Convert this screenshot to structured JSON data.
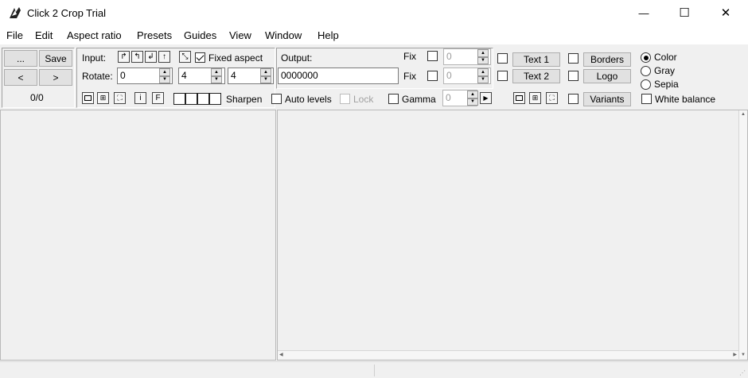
{
  "window": {
    "title": "Click 2 Crop Trial",
    "minimize_glyph": "—",
    "maximize_glyph": "☐",
    "close_glyph": "✕"
  },
  "menu": [
    "File",
    "Edit",
    "Aspect ratio",
    "Presets",
    "Guides",
    "View",
    "Window",
    "Help"
  ],
  "nav": {
    "browse_label": "...",
    "save_label": "Save",
    "prev_label": "<",
    "next_label": ">",
    "counter": "0/0"
  },
  "input": {
    "label": "Input:",
    "rotate_label": "Rotate:",
    "rotate_value": "0",
    "aspect_w": "4",
    "aspect_h": "4",
    "fixed_aspect_label": "Fixed aspect",
    "fixed_aspect_checked": true,
    "sharpen_label": "Sharpen",
    "auto_levels_label": "Auto levels",
    "lock_label": "Lock",
    "gamma_label": "Gamma",
    "gamma_value": "0"
  },
  "output": {
    "label": "Output:",
    "value": "0000000",
    "fix_label_1": "Fix",
    "fix_value_1": "0",
    "fix_label_2": "Fix",
    "fix_value_2": "0"
  },
  "overlays": {
    "text1_label": "Text 1",
    "text2_label": "Text 2",
    "borders_label": "Borders",
    "logo_label": "Logo",
    "variants_label": "Variants"
  },
  "color_mode": {
    "options": [
      "Color",
      "Gray",
      "Sepia"
    ],
    "selected": "Color",
    "white_balance_label": "White balance"
  },
  "icons": {
    "glyph_rotate_cw": "↱",
    "glyph_rotate_ccw": "↰",
    "glyph_flip": "↲",
    "glyph_up": "↑",
    "glyph_shrink": "⤡",
    "glyph_info": "i",
    "glyph_text": "F",
    "glyph_up_small": "▲",
    "glyph_down_small": "▼",
    "glyph_right_small": "▶"
  }
}
